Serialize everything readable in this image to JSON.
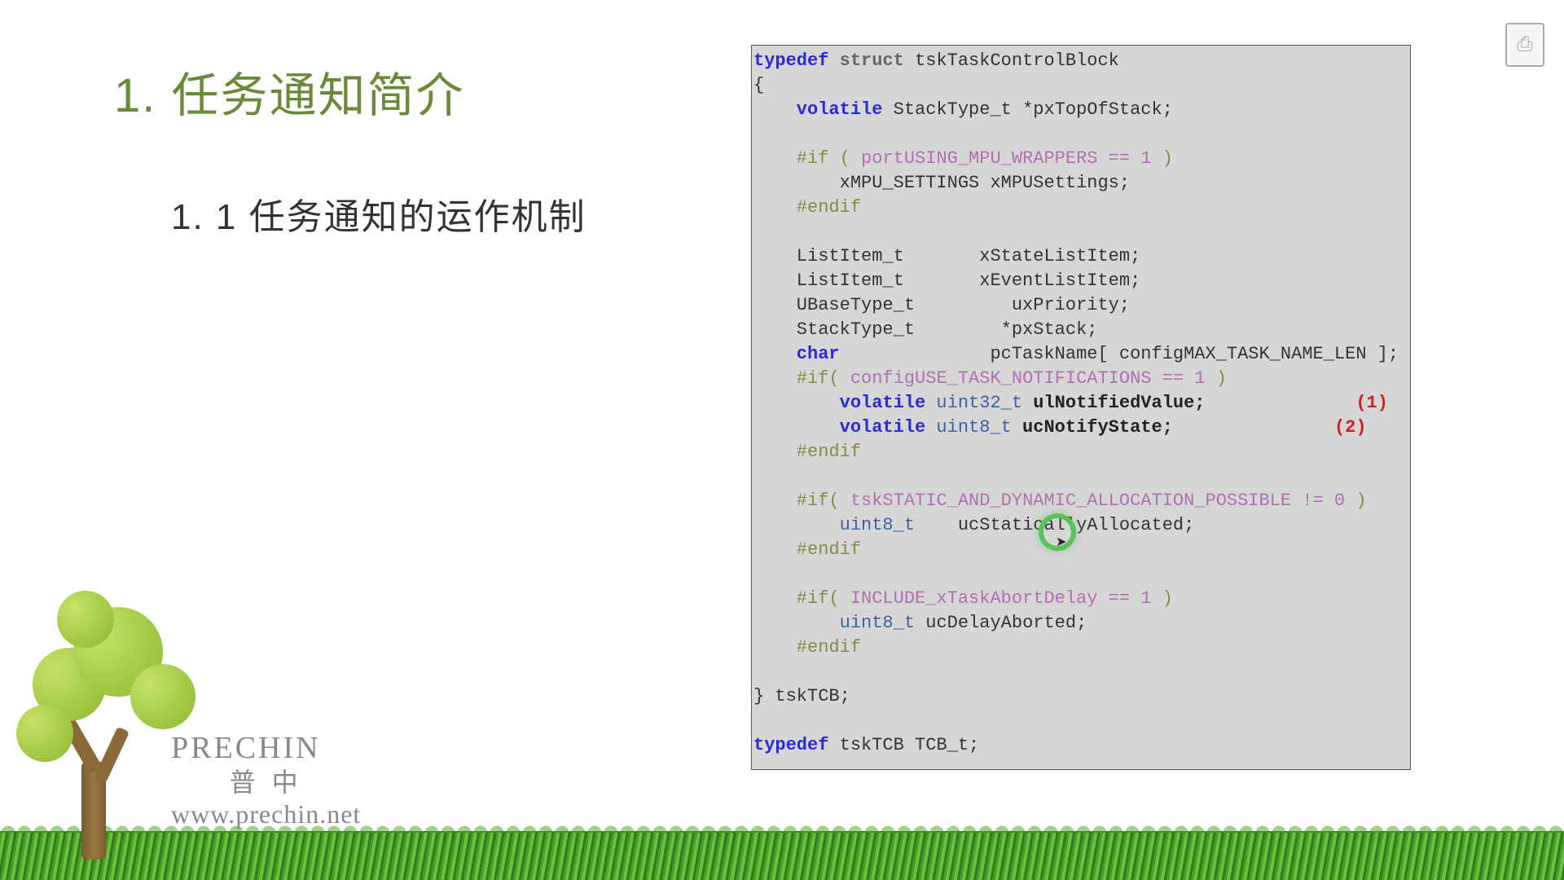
{
  "heading": "1. 任务通知简介",
  "subheading": "1. 1 任务通知的运作机制",
  "brand": {
    "en": "PRECHIN",
    "cn": "普 中",
    "url": "www.prechin.net"
  },
  "corner_icon_glyph": "⎙",
  "code": {
    "l01a": "typedef",
    "l01b": " struct",
    "l01c": " tskTaskControlBlock",
    "l02": "{",
    "l03a": "    volatile",
    "l03b": " StackType_t *pxTopOfStack;",
    "l04": "",
    "l05a": "    #if ( ",
    "l05b": "portUSING_MPU_WRAPPERS == 1",
    "l05c": " )",
    "l06": "        xMPU_SETTINGS xMPUSettings;",
    "l07": "    #endif",
    "l08": "",
    "l09": "    ListItem_t       xStateListItem;",
    "l10": "    ListItem_t       xEventListItem;",
    "l11": "    UBaseType_t         uxPriority;",
    "l12": "    StackType_t        *pxStack;",
    "l13a": "    char",
    "l13b": "              pcTaskName[ configMAX_TASK_NAME_LEN ];",
    "l14a": "    #if( ",
    "l14b": "configUSE_TASK_NOTIFICATIONS == 1",
    "l14c": " )",
    "l15a": "        volatile",
    "l15b": " uint32_t",
    "l15c": " ulNotifiedValue;",
    "l15d": "              (1)",
    "l16a": "        volatile",
    "l16b": " uint8_t",
    "l16c": " ucNotifyState;",
    "l16d": "               (2)",
    "l17": "    #endif",
    "l18": "",
    "l19a": "    #if( ",
    "l19b": "tskSTATIC_AND_DYNAMIC_ALLOCATION_POSSIBLE != 0",
    "l19c": " )",
    "l20a": "        uint8_t",
    "l20b": "    ucStaticallyAllocated;",
    "l21": "    #endif",
    "l22": "",
    "l23a": "    #if( ",
    "l23b": "INCLUDE_xTaskAbortDelay == 1",
    "l23c": " )",
    "l24a": "        uint8_t",
    "l24b": " ucDelayAborted;",
    "l25": "    #endif",
    "l26": "",
    "l27": "} tskTCB;",
    "l28": "",
    "l29a": "typedef",
    "l29b": " tskTCB TCB_t;"
  }
}
